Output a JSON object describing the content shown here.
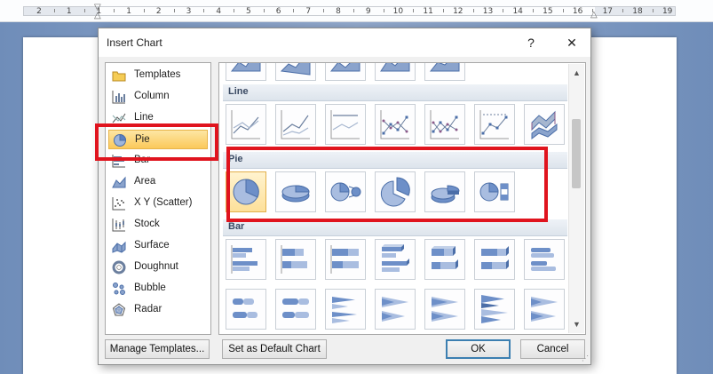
{
  "ruler": {
    "numbers": [
      "2",
      "1",
      "1",
      "1",
      "2",
      "3",
      "4",
      "5",
      "6",
      "7",
      "8",
      "9",
      "10",
      "11",
      "12",
      "13",
      "14",
      "15",
      "16",
      "17",
      "18",
      "19"
    ]
  },
  "dialog": {
    "title": "Insert Chart",
    "help": "?",
    "close": "✕",
    "chart_types": [
      {
        "label": "Templates",
        "icon": "folder-icon"
      },
      {
        "label": "Column",
        "icon": "column-chart-icon"
      },
      {
        "label": "Line",
        "icon": "line-chart-icon"
      },
      {
        "label": "Pie",
        "icon": "pie-chart-icon",
        "selected": true
      },
      {
        "label": "Bar",
        "icon": "bar-chart-icon"
      },
      {
        "label": "Area",
        "icon": "area-chart-icon"
      },
      {
        "label": "X Y (Scatter)",
        "icon": "scatter-chart-icon"
      },
      {
        "label": "Stock",
        "icon": "stock-chart-icon"
      },
      {
        "label": "Surface",
        "icon": "surface-chart-icon"
      },
      {
        "label": "Doughnut",
        "icon": "doughnut-chart-icon"
      },
      {
        "label": "Bubble",
        "icon": "bubble-chart-icon"
      },
      {
        "label": "Radar",
        "icon": "radar-chart-icon"
      }
    ],
    "sections": {
      "line": "Line",
      "pie": "Pie",
      "bar": "Bar"
    },
    "buttons": {
      "manage_templates": "Manage Templates...",
      "set_default": "Set as Default Chart",
      "ok": "OK",
      "cancel": "Cancel"
    }
  },
  "colors": {
    "highlight": "#e0141e",
    "selected_bg": "#fbc95a",
    "chart_blue": "#5a7fc0"
  }
}
